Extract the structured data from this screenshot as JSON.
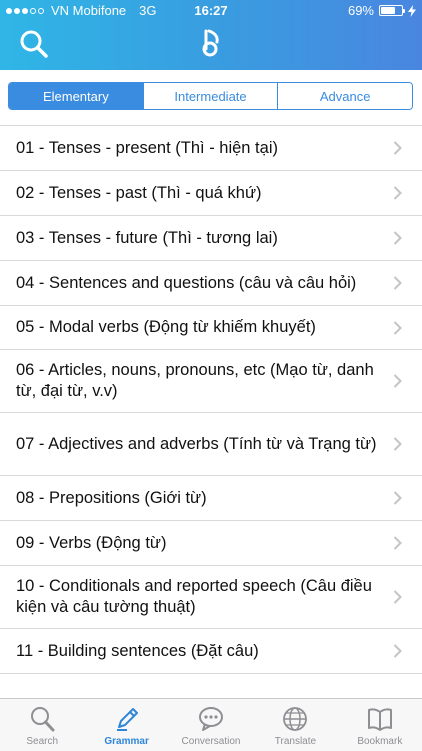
{
  "status_bar": {
    "carrier": "VN Mobifone",
    "network": "3G",
    "time": "16:27",
    "battery": "69%",
    "battery_level": 0.69
  },
  "header": {
    "search_icon": "search-icon",
    "logo_icon": "music-note-logo"
  },
  "levels": [
    {
      "label": "Elementary",
      "active": true
    },
    {
      "label": "Intermediate",
      "active": false
    },
    {
      "label": "Advance",
      "active": false
    }
  ],
  "lessons": [
    {
      "label": "01 - Tenses - present (Thì -  hiện tại)"
    },
    {
      "label": "02 - Tenses - past (Thì - quá khứ)"
    },
    {
      "label": "03 - Tenses - future (Thì - tương lai)"
    },
    {
      "label": "04 - Sentences and questions (câu và câu hỏi)"
    },
    {
      "label": "05 - Modal verbs  (Động từ khiếm khuyết)"
    },
    {
      "label": "06 - Articles, nouns, pronouns, etc (Mạo từ, danh từ, đại từ, v.v)"
    },
    {
      "label": "07 - Adjectives and adverbs (Tính từ và Trạng từ)"
    },
    {
      "label": "08 - Prepositions (Giới từ)"
    },
    {
      "label": "09 - Verbs (Động từ)"
    },
    {
      "label": "10 - Conditionals and reported speech (Câu điều kiện và câu tường thuật)"
    },
    {
      "label": "11 - Building sentences (Đặt câu)"
    }
  ],
  "tabs": [
    {
      "label": "Search",
      "icon": "search-icon",
      "active": false
    },
    {
      "label": "Grammar",
      "icon": "pencil-icon",
      "active": true
    },
    {
      "label": "Conversation",
      "icon": "chat-bubble-icon",
      "active": false
    },
    {
      "label": "Translate",
      "icon": "globe-icon",
      "active": false
    },
    {
      "label": "Bookmark",
      "icon": "book-icon",
      "active": false
    }
  ],
  "colors": {
    "accent": "#3a8ce0",
    "header_start": "#2fb6e6",
    "header_end": "#4a86e0",
    "tab_active": "#2f86d9",
    "tab_inactive": "#8e8e93"
  }
}
